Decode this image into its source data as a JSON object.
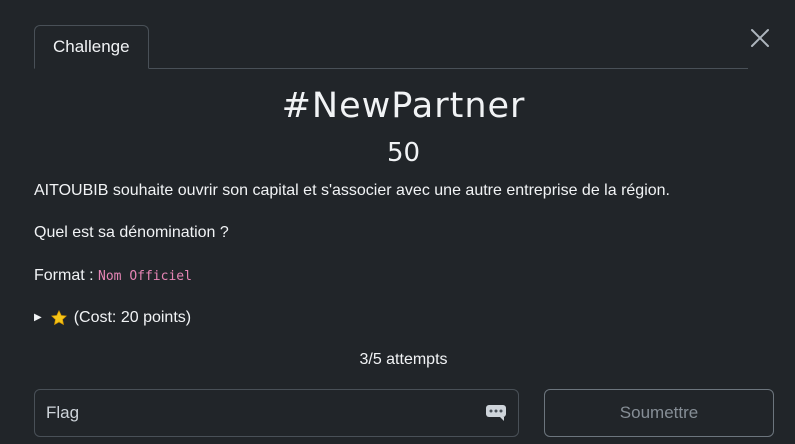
{
  "tabs": [
    {
      "label": "Challenge"
    }
  ],
  "challenge": {
    "title": "#NewPartner",
    "points": "50",
    "description_1": "AITOUBIB souhaite ouvrir son capital et s'associer avec une autre entreprise de la région.",
    "description_2": "Quel est sa dénomination ?",
    "format_label": "Format : ",
    "format_code": "Nom Officiel"
  },
  "hint": {
    "icon": "star-icon",
    "label": "(Cost: 20 points)"
  },
  "attempts": "3/5 attempts",
  "form": {
    "flag_placeholder": "Flag",
    "submit_label": "Soumettre"
  },
  "colors": {
    "background": "#212529",
    "border": "#495057",
    "code_pink": "#e685b5",
    "star": "#f5c518"
  }
}
